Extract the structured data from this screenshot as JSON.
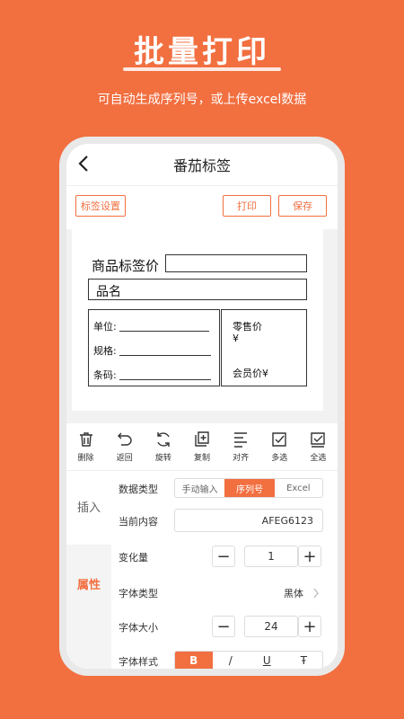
{
  "promo": {
    "title": "批量打印",
    "subtitle": "可自动生成序列号，或上传excel数据"
  },
  "nav": {
    "title": "番茄标签"
  },
  "toolbar": {
    "label_settings": "标签设置",
    "print": "打印",
    "save": "保存"
  },
  "label": {
    "title": "商品标签价",
    "name": "品名",
    "fields": [
      "单位:",
      "规格:",
      "条码:"
    ],
    "retail_price": "零售价",
    "currency": "¥",
    "member_price": "会员价¥"
  },
  "tools": [
    {
      "label": "删除",
      "icon": "trash-icon"
    },
    {
      "label": "返回",
      "icon": "undo-icon"
    },
    {
      "label": "旋转",
      "icon": "rotate-icon"
    },
    {
      "label": "复制",
      "icon": "copy-icon"
    },
    {
      "label": "对齐",
      "icon": "align-icon"
    },
    {
      "label": "多选",
      "icon": "multiselect-icon"
    },
    {
      "label": "全选",
      "icon": "selectall-icon"
    }
  ],
  "sidebar": {
    "insert": "插入",
    "properties": "属性"
  },
  "props": {
    "data_type_label": "数据类型",
    "data_type_options": [
      "手动输入",
      "序列号",
      "Excel"
    ],
    "data_type_selected": "序列号",
    "current_content_label": "当前内容",
    "current_content_value": "AFEG6123",
    "change_label": "变化量",
    "change_value": "1",
    "font_type_label": "字体类型",
    "font_type_value": "黑体",
    "font_size_label": "字体大小",
    "font_size_value": "24",
    "font_style_label": "字体样式",
    "font_style_options": [
      "B",
      "/",
      "U",
      "Ŧ"
    ],
    "font_style_selected": "B",
    "minus": "−",
    "plus": "+"
  },
  "colors": {
    "accent": "#f26f40",
    "background": "#f26f40"
  }
}
